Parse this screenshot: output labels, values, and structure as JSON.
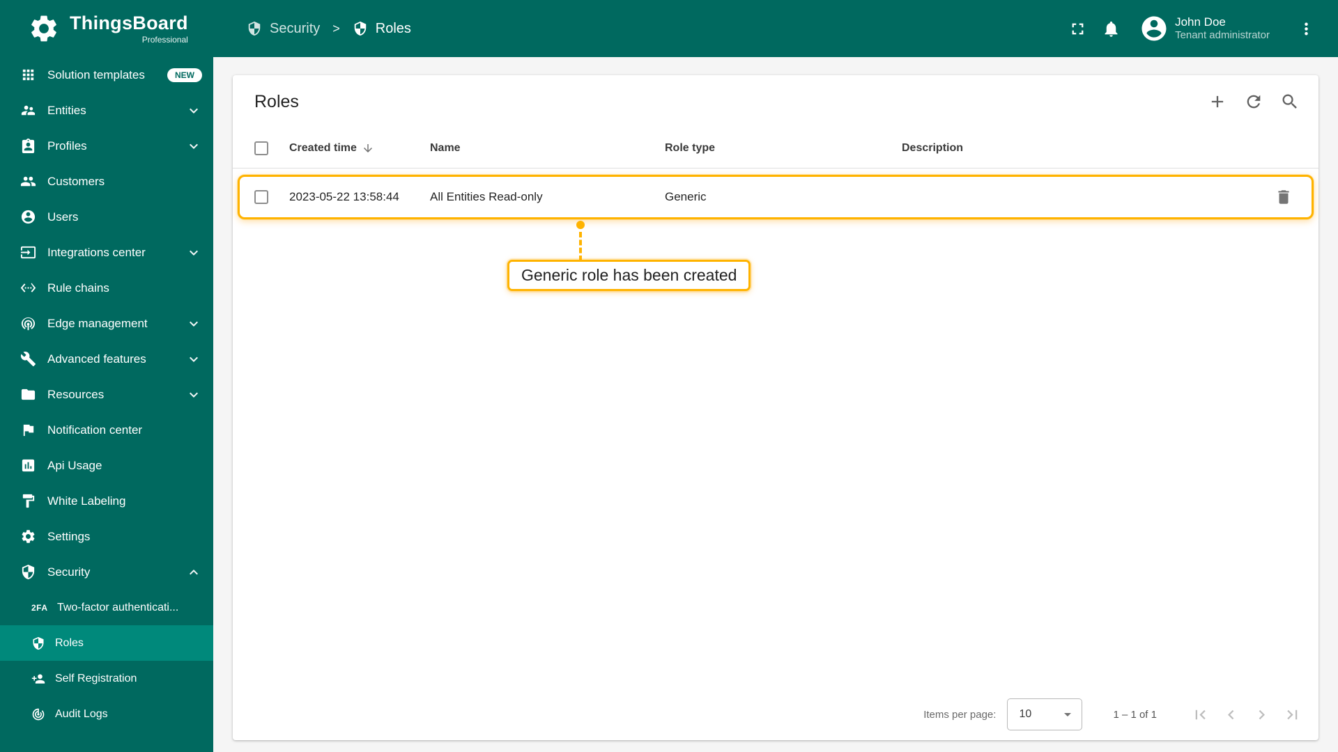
{
  "app": {
    "name": "ThingsBoard",
    "edition": "Professional"
  },
  "sidebar": {
    "items": [
      {
        "label": "Solution templates",
        "badge": "NEW"
      },
      {
        "label": "Entities"
      },
      {
        "label": "Profiles"
      },
      {
        "label": "Customers"
      },
      {
        "label": "Users"
      },
      {
        "label": "Integrations center"
      },
      {
        "label": "Rule chains"
      },
      {
        "label": "Edge management"
      },
      {
        "label": "Advanced features"
      },
      {
        "label": "Resources"
      },
      {
        "label": "Notification center"
      },
      {
        "label": "Api Usage"
      },
      {
        "label": "White Labeling"
      },
      {
        "label": "Settings"
      },
      {
        "label": "Security"
      }
    ],
    "security_submenu": [
      {
        "label": "Two-factor authenticati..."
      },
      {
        "label": "Roles"
      },
      {
        "label": "Self Registration"
      },
      {
        "label": "Audit Logs"
      }
    ],
    "two_factor_icon_text": "2FA"
  },
  "header": {
    "breadcrumb": {
      "parent": "Security",
      "separator": ">",
      "current": "Roles"
    },
    "user": {
      "name": "John Doe",
      "role": "Tenant administrator"
    }
  },
  "content": {
    "title": "Roles",
    "table": {
      "headers": {
        "created_time": "Created time",
        "name": "Name",
        "role_type": "Role type",
        "description": "Description"
      },
      "rows": [
        {
          "created_time": "2023-05-22 13:58:44",
          "name": "All Entities Read-only",
          "role_type": "Generic",
          "description": ""
        }
      ]
    },
    "tutorial_tooltip": "Generic role has been created",
    "paginator": {
      "items_per_page_label": "Items per page:",
      "items_per_page_value": "10",
      "range_label": "1 – 1 of 1"
    }
  },
  "colors": {
    "primary": "#00695F",
    "sidebar_active": "#00897B",
    "highlight": "#FFB300",
    "content_bg": "#F5F5F5"
  }
}
